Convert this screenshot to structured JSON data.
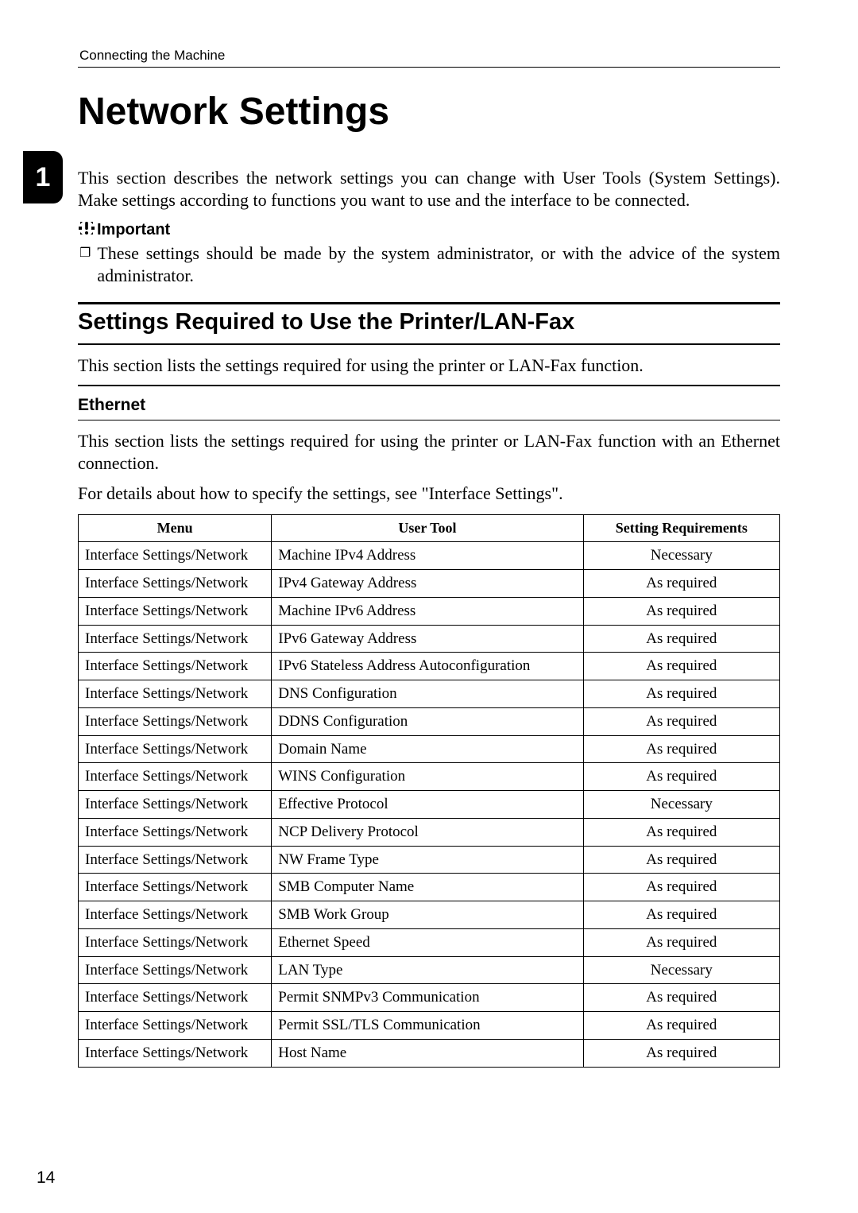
{
  "running_head": "Connecting the Machine",
  "chapter_number": "1",
  "title": "Network Settings",
  "intro_paragraph": "This section describes the network settings you can change with User Tools (System Settings). Make settings according to functions you want to use and the interface to be connected.",
  "important_label": "Important",
  "important_bullet": "These settings should be made by the system administrator, or with the advice of the system administrator.",
  "section_heading": "Settings Required to Use the Printer/LAN-Fax",
  "section_intro": "This section lists the settings required for using the printer or LAN-Fax function.",
  "subsection_heading": "Ethernet",
  "subsection_p1": "This section lists the settings required for using the printer or LAN-Fax function with an Ethernet connection.",
  "subsection_p2": "For details about how to specify the settings, see \"Interface Settings\".",
  "table": {
    "headers": {
      "menu": "Menu",
      "tool": "User Tool",
      "req": "Setting Requirements"
    },
    "rows": [
      {
        "menu": "Interface Settings/Network",
        "tool": "Machine IPv4 Address",
        "req": "Necessary"
      },
      {
        "menu": "Interface Settings/Network",
        "tool": "IPv4 Gateway Address",
        "req": "As required"
      },
      {
        "menu": "Interface Settings/Network",
        "tool": "Machine IPv6 Address",
        "req": "As required"
      },
      {
        "menu": "Interface Settings/Network",
        "tool": "IPv6 Gateway Address",
        "req": "As required"
      },
      {
        "menu": "Interface Settings/Network",
        "tool": "IPv6 Stateless Address Autoconfiguration",
        "req": "As required"
      },
      {
        "menu": "Interface Settings/Network",
        "tool": "DNS Configuration",
        "req": "As required"
      },
      {
        "menu": "Interface Settings/Network",
        "tool": "DDNS Configuration",
        "req": "As required"
      },
      {
        "menu": "Interface Settings/Network",
        "tool": "Domain Name",
        "req": "As required"
      },
      {
        "menu": "Interface Settings/Network",
        "tool": "WINS Configuration",
        "req": "As required"
      },
      {
        "menu": "Interface Settings/Network",
        "tool": "Effective Protocol",
        "req": "Necessary"
      },
      {
        "menu": "Interface Settings/Network",
        "tool": "NCP Delivery Protocol",
        "req": "As required"
      },
      {
        "menu": "Interface Settings/Network",
        "tool": "NW Frame Type",
        "req": "As required"
      },
      {
        "menu": "Interface Settings/Network",
        "tool": "SMB Computer Name",
        "req": "As required"
      },
      {
        "menu": "Interface Settings/Network",
        "tool": "SMB Work Group",
        "req": "As required"
      },
      {
        "menu": "Interface Settings/Network",
        "tool": "Ethernet Speed",
        "req": "As required"
      },
      {
        "menu": "Interface Settings/Network",
        "tool": "LAN Type",
        "req": "Necessary"
      },
      {
        "menu": "Interface Settings/Network",
        "tool": "Permit SNMPv3 Communication",
        "req": "As required"
      },
      {
        "menu": "Interface Settings/Network",
        "tool": "Permit SSL/TLS Communication",
        "req": "As required"
      },
      {
        "menu": "Interface Settings/Network",
        "tool": "Host Name",
        "req": "As required"
      }
    ]
  },
  "page_number": "14"
}
